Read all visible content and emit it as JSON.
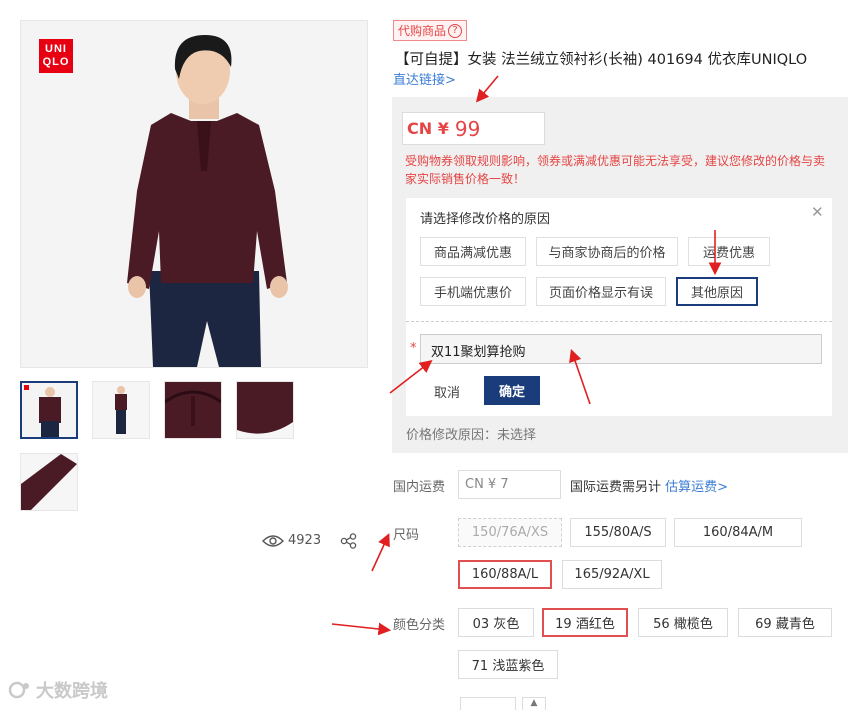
{
  "gallery": {
    "brand_logo_line1": "UNI",
    "brand_logo_line2": "QLO"
  },
  "stats": {
    "view_count": "4923"
  },
  "product": {
    "tag": "代购商品",
    "title": "【可自提】女装 法兰绒立领衬衫(长袖) 401694 优衣库UNIQLO",
    "direct_link": "直达链接>"
  },
  "price": {
    "currency": "CN ¥",
    "value": "99",
    "warning": "受购物券领取规则影响，领券或满减优惠可能无法享受，建议您修改的价格与卖家实际销售价格一致！"
  },
  "reason_dialog": {
    "title": "请选择修改价格的原因",
    "options": [
      "商品满减优惠",
      "与商家协商后的价格",
      "运费优惠",
      "手机端优惠价",
      "页面价格显示有误",
      "其他原因"
    ],
    "selected": "其他原因",
    "required_mark": "*",
    "input_value": "双11聚划算抢购",
    "cancel_label": "取消",
    "confirm_label": "确定"
  },
  "reason_status": "价格修改原因：未选择",
  "shipping": {
    "label": "国内运费",
    "value": "CN ¥ 7",
    "note": "国际运费需另计",
    "estimate_link": "估算运费>"
  },
  "size": {
    "label": "尺码",
    "options": [
      "150/76A/XS",
      "155/80A/S",
      "160/84A/M",
      "160/88A/L",
      "165/92A/XL"
    ],
    "disabled": "150/76A/XS",
    "selected": "160/88A/L"
  },
  "color": {
    "label": "颜色分类",
    "options": [
      "03 灰色",
      "19 酒红色",
      "56 橄榄色",
      "69 藏青色",
      "71 浅蓝紫色"
    ],
    "selected": "19 酒红色"
  },
  "watermark": "大数跨境",
  "colors": {
    "accent_red": "#e64545",
    "navy": "#1a3c7a",
    "link_blue": "#3c7dd6",
    "shirt": "#4a1a25"
  }
}
